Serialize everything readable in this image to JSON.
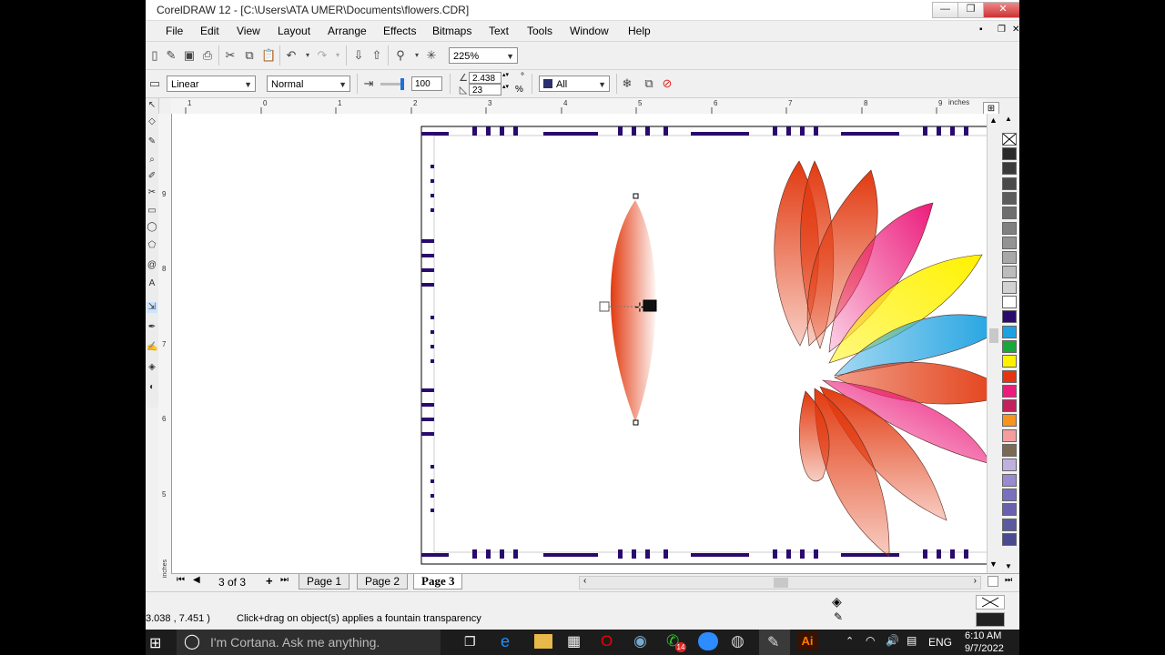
{
  "window": {
    "title": "CorelDRAW 12 - [C:\\Users\\ATA UMER\\Documents\\flowers.CDR]",
    "min": "—",
    "max": "❐",
    "close": "✕"
  },
  "menu": [
    "File",
    "Edit",
    "View",
    "Layout",
    "Arrange",
    "Effects",
    "Bitmaps",
    "Text",
    "Tools",
    "Window",
    "Help"
  ],
  "toolbar": {
    "zoom": "225%"
  },
  "propbar": {
    "transparency_type": "Linear",
    "merge_mode": "Normal",
    "opacity": "100",
    "angle": "2.438",
    "edge_pad": "23",
    "edge_unit": "%",
    "degree_sign": "°",
    "target": "All"
  },
  "ruler": {
    "units": "inches",
    "h_labels": [
      "1",
      "0",
      "1",
      "2",
      "3",
      "4",
      "5",
      "6",
      "7",
      "8",
      "9"
    ],
    "v_labels": [
      "9",
      "8",
      "7",
      "6",
      "5"
    ],
    "v_units": "inches"
  },
  "pages": {
    "counter": "3 of 3",
    "tabs": [
      "Page 1",
      "Page 2",
      "Page 3"
    ],
    "active": "Page 3"
  },
  "status": {
    "coords": "3.038 , 7.451 )",
    "hint": "Click+drag on object(s) applies a fountain transparency"
  },
  "taskbar": {
    "search": "I'm Cortana. Ask me anything.",
    "lang": "ENG",
    "time": "6:10 AM",
    "date": "9/7/2022",
    "badge": "14"
  },
  "palette_colors": [
    "#2b2b2b",
    "#3a3a3a",
    "#4a4a4a",
    "#5c5c5c",
    "#6e6e6e",
    "#808080",
    "#939393",
    "#a8a8a8",
    "#bcbcbc",
    "#d2d2d2",
    "#ffffff",
    "#2a0a6e",
    "#1ba1e2",
    "#18a83a",
    "#fff200",
    "#e63312",
    "#ed1c7c",
    "#c3225d",
    "#f7941d",
    "#f59c9c",
    "#7a6a55",
    "#c0b0e0",
    "#9a8ad0",
    "#7a70c0",
    "#6a60b0",
    "#5a5aa0",
    "#4a4a90"
  ],
  "colors": {
    "petal_red": "#e23a10",
    "petal_pink": "#ec1c7c",
    "petal_yellow": "#fff200",
    "petal_blue": "#1aa0e0",
    "border_navy": "#2a0a6e"
  }
}
